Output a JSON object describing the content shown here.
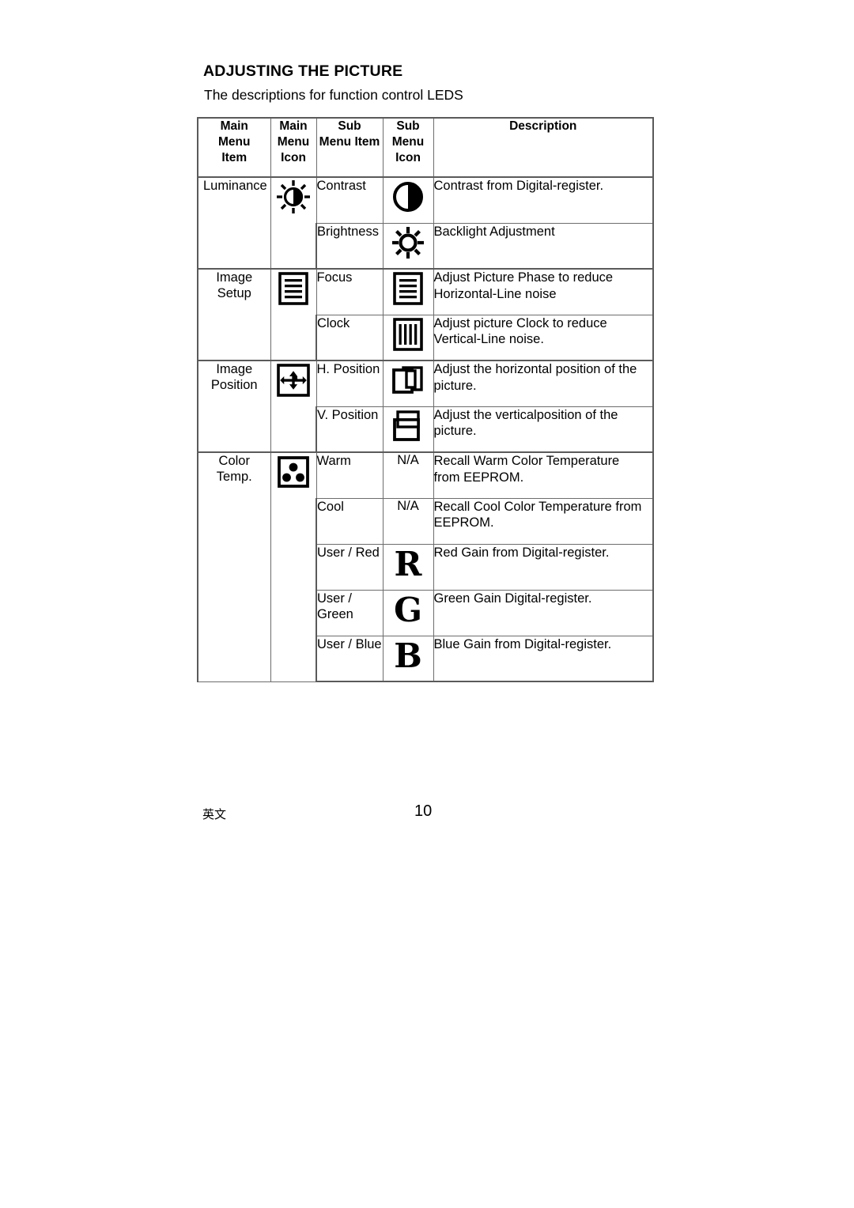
{
  "document": {
    "heading": "ADJUSTING THE PICTURE",
    "subheading": "The descriptions for function control LEDS"
  },
  "table": {
    "headers": {
      "main_menu_item": "Main\nMenu\nItem",
      "main_menu_item_l1": "Main",
      "main_menu_item_l2": "Menu",
      "main_menu_item_l3": "Item",
      "main_menu_icon_l1": "Main",
      "main_menu_icon_l2": "Menu",
      "main_menu_icon_l3": "Icon",
      "sub_menu_item_l1": "Sub",
      "sub_menu_item_l2": "Menu Item",
      "sub_menu_icon_l1": "Sub",
      "sub_menu_icon_l2": "Menu",
      "sub_menu_icon_l3": "Icon",
      "description": "Description"
    },
    "groups": [
      {
        "main_menu_item": "Luminance",
        "main_menu_icon": "sun-contrast-icon",
        "rows": [
          {
            "sub_menu_item": "Contrast",
            "sub_menu_icon": "half-filled-circle-icon",
            "description": "Contrast from Digital-register."
          },
          {
            "sub_menu_item": "Brightness",
            "sub_menu_icon": "sun-icon",
            "description": "Backlight Adjustment"
          }
        ]
      },
      {
        "main_menu_item_l1": "Image",
        "main_menu_item_l2": "Setup",
        "main_menu_icon": "horizontal-lines-frame-icon",
        "rows": [
          {
            "sub_menu_item": "Focus",
            "sub_menu_icon": "horizontal-lines-frame-icon",
            "description_l1": "Adjust Picture Phase to reduce",
            "description_l2": "Horizontal-Line noise"
          },
          {
            "sub_menu_item": "Clock",
            "sub_menu_icon": "vertical-lines-frame-icon",
            "description_l1": "Adjust picture Clock to reduce",
            "description_l2": "Vertical-Line noise."
          }
        ]
      },
      {
        "main_menu_item_l1": "Image",
        "main_menu_item_l2": "Position",
        "main_menu_icon": "four-way-arrows-icon",
        "rows": [
          {
            "sub_menu_item": "H. Position",
            "sub_menu_icon": "horizontal-shift-frames-icon",
            "description_l1": "Adjust the horizontal position of the",
            "description_l2": "picture."
          },
          {
            "sub_menu_item": "V. Position",
            "sub_menu_icon": "vertical-shift-frames-icon",
            "description_l1": "Adjust the verticalposition of the",
            "description_l2": "picture."
          }
        ]
      },
      {
        "main_menu_item_l1": "Color",
        "main_menu_item_l2": "Temp.",
        "main_menu_icon": "three-dots-frame-icon",
        "rows": [
          {
            "sub_menu_item": "Warm",
            "sub_menu_icon": "N/A",
            "description_l1": "Recall Warm Color Temperature",
            "description_l2": "from EEPROM."
          },
          {
            "sub_menu_item": "Cool",
            "sub_menu_icon": "N/A",
            "description_l1": "Recall Cool Color Temperature from",
            "description_l2": "EEPROM."
          },
          {
            "sub_menu_item": "User / Red",
            "sub_menu_icon": "letter-r-icon",
            "description_l1": "Red Gain from Digital-register.",
            "description_l2": ""
          },
          {
            "sub_menu_item_l1": "User /",
            "sub_menu_item_l2": "Green",
            "sub_menu_icon": "letter-g-icon",
            "description_l1": "Green Gain Digital-register.",
            "description_l2": ""
          },
          {
            "sub_menu_item": "User / Blue",
            "sub_menu_icon": "letter-b-icon",
            "description_l1": "Blue Gain from Digital-register.",
            "description_l2": ""
          }
        ]
      }
    ]
  },
  "footer": {
    "language_mark": "英文",
    "page_number": "10"
  },
  "colors": {
    "ink": "#000000",
    "border": "#6d6d6d",
    "background": "#ffffff"
  }
}
